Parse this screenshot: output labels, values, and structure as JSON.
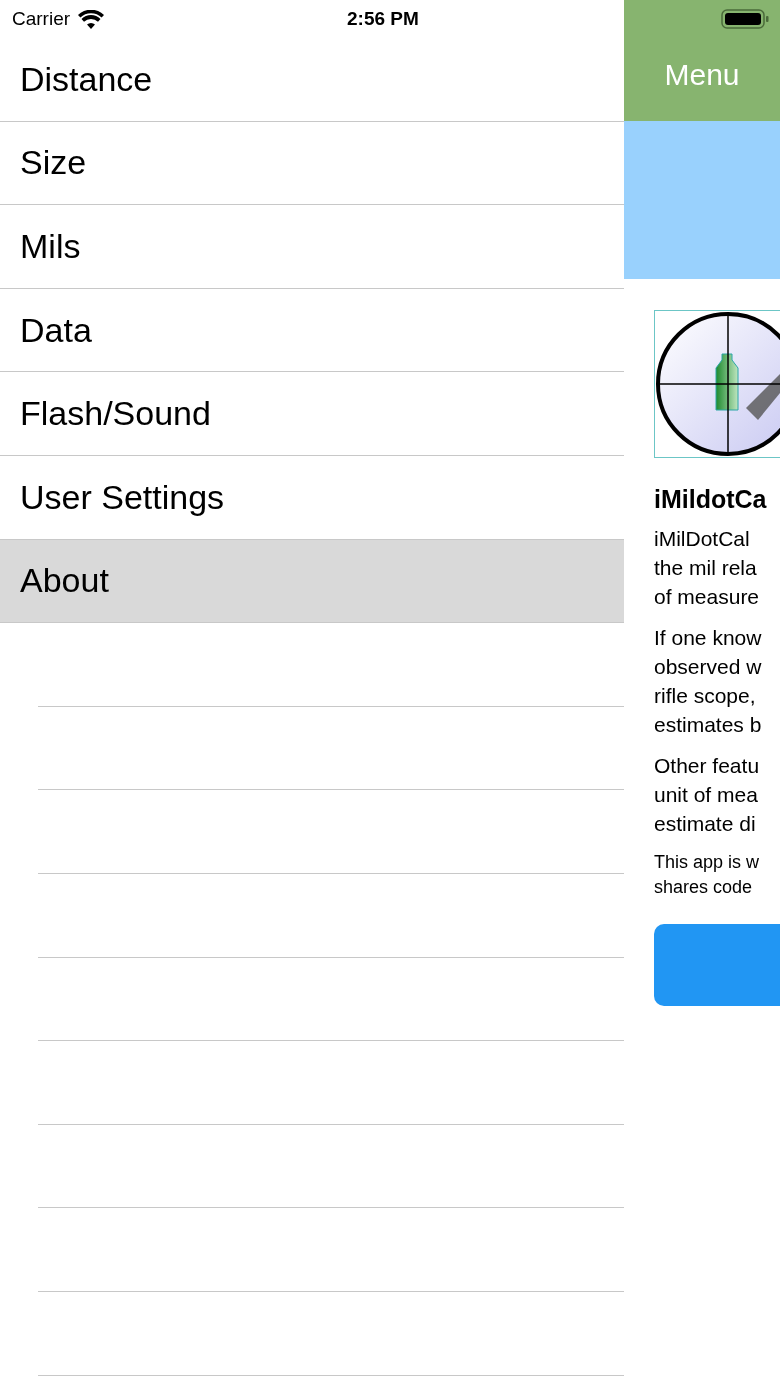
{
  "status_bar": {
    "carrier": "Carrier",
    "time": "2:56 PM"
  },
  "menu": [
    {
      "label": "Distance",
      "selected": false
    },
    {
      "label": "Size",
      "selected": false
    },
    {
      "label": "Mils",
      "selected": false
    },
    {
      "label": "Data",
      "selected": false
    },
    {
      "label": "Flash/Sound",
      "selected": false
    },
    {
      "label": "User Settings",
      "selected": false
    },
    {
      "label": "About",
      "selected": true
    }
  ],
  "header": {
    "title": "Menu"
  },
  "about": {
    "heading": "iMildotCa",
    "paragraphs": [
      {
        "kind": "body",
        "lines": [
          "iMilDotCal",
          "the mil rela",
          "of measure"
        ]
      },
      {
        "kind": "body",
        "lines": [
          "If one know",
          "observed w",
          "rifle scope,",
          "estimates b"
        ]
      },
      {
        "kind": "body",
        "lines": [
          "Other featu",
          "unit of mea",
          "estimate di"
        ]
      },
      {
        "kind": "note",
        "lines": [
          "This app is w",
          "shares code"
        ]
      }
    ]
  }
}
